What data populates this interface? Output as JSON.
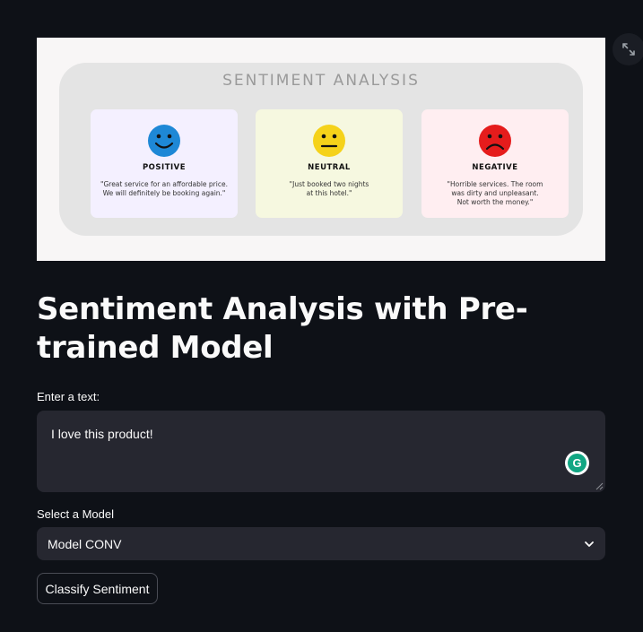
{
  "banner": {
    "title": "SENTIMENT ANALYSIS",
    "cards": [
      {
        "label": "POSITIVE",
        "quote": "\"Great service for an affordable price.\nWe will definitely be booking again.\"",
        "color": "#1e88d6"
      },
      {
        "label": "NEUTRAL",
        "quote": "\"Just booked two nights\nat this hotel.\"",
        "color": "#f5d21a"
      },
      {
        "label": "NEGATIVE",
        "quote": "\"Horrible services. The room\nwas dirty and unpleasant.\nNot worth the money.\"",
        "color": "#e51c1c"
      }
    ]
  },
  "page": {
    "title": "Sentiment Analysis with Pre-trained Model"
  },
  "text_input": {
    "label": "Enter a text:",
    "value": "I love this product!"
  },
  "model_select": {
    "label": "Select a Model",
    "selected": "Model CONV"
  },
  "classify_button": {
    "label": "Classify Sentiment"
  },
  "icons": {
    "expand": "fullscreen-expand-icon",
    "grammarly": "grammarly-icon",
    "grammarly_letter": "G",
    "dropdown": "chevron-down-icon"
  }
}
